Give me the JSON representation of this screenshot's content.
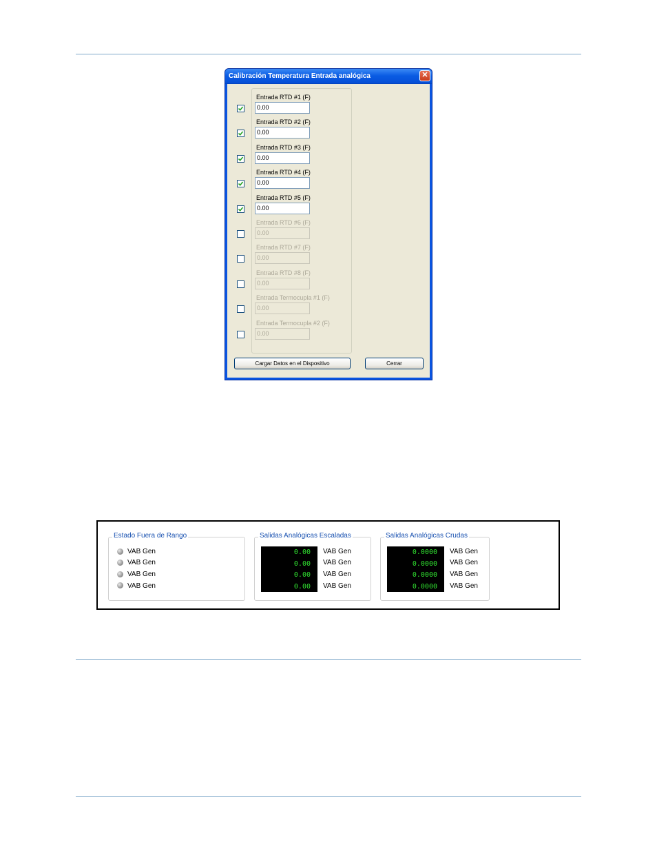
{
  "dialog": {
    "title": "Calibración Temperatura Entrada analógica",
    "close_glyph": "✕",
    "rows": [
      {
        "label": "Entrada RTD #1 (F)",
        "value": "0.00",
        "checked": true
      },
      {
        "label": "Entrada RTD #2 (F)",
        "value": "0.00",
        "checked": true
      },
      {
        "label": "Entrada RTD #3 (F)",
        "value": "0.00",
        "checked": true
      },
      {
        "label": "Entrada RTD #4 (F)",
        "value": "0.00",
        "checked": true
      },
      {
        "label": "Entrada RTD #5 (F)",
        "value": "0.00",
        "checked": true
      },
      {
        "label": "Entrada RTD #6 (F)",
        "value": "0.00",
        "checked": false
      },
      {
        "label": "Entrada RTD #7 (F)",
        "value": "0.00",
        "checked": false
      },
      {
        "label": "Entrada RTD #8 (F)",
        "value": "0.00",
        "checked": false
      },
      {
        "label": "Entrada Termocupla #1 (F)",
        "value": "0.00",
        "checked": false
      },
      {
        "label": "Entrada Termocupla #2 (F)",
        "value": "0.00",
        "checked": false
      }
    ],
    "load_button": "Cargar Datos en el Dispositivo",
    "close_button": "Cerrar"
  },
  "panel": {
    "out_of_range": {
      "title": "Estado Fuera de Rango",
      "items": [
        "VAB Gen",
        "VAB Gen",
        "VAB Gen",
        "VAB Gen"
      ]
    },
    "scaled": {
      "title": "Salidas Analógicas Escaladas",
      "values": [
        "0.00",
        "0.00",
        "0.00",
        "0.00"
      ],
      "labels": [
        "VAB Gen",
        "VAB Gen",
        "VAB Gen",
        "VAB Gen"
      ]
    },
    "raw": {
      "title": "Salidas Analógicas Crudas",
      "values": [
        "0.0000",
        "0.0000",
        "0.0000",
        "0.0000"
      ],
      "labels": [
        "VAB Gen",
        "VAB Gen",
        "VAB Gen",
        "VAB Gen"
      ]
    }
  },
  "colors": {
    "titlebar": "#0a5ce3",
    "dialog_bg": "#ece9d8",
    "display_text": "#30e030",
    "group_title": "#1750b0"
  }
}
